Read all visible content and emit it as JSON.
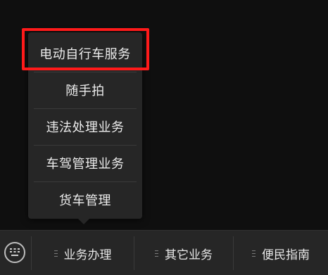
{
  "popup_menu": {
    "items": [
      {
        "label": "电动自行车服务"
      },
      {
        "label": "随手拍"
      },
      {
        "label": "违法处理业务"
      },
      {
        "label": "车驾管理业务"
      },
      {
        "label": "货车管理"
      }
    ],
    "highlighted_item": "电动自行车服务",
    "highlight_color": "#ff1a1a"
  },
  "bottom_bar": {
    "keyboard_icon": "keyboard-icon",
    "tabs": [
      {
        "label": "业务办理",
        "icon": "menu-lines-icon"
      },
      {
        "label": "其它业务",
        "icon": "menu-lines-icon"
      },
      {
        "label": "便民指南",
        "icon": "menu-lines-icon"
      }
    ]
  },
  "colors": {
    "background": "#0f0f0f",
    "panel": "#262626",
    "text": "#ededed"
  }
}
